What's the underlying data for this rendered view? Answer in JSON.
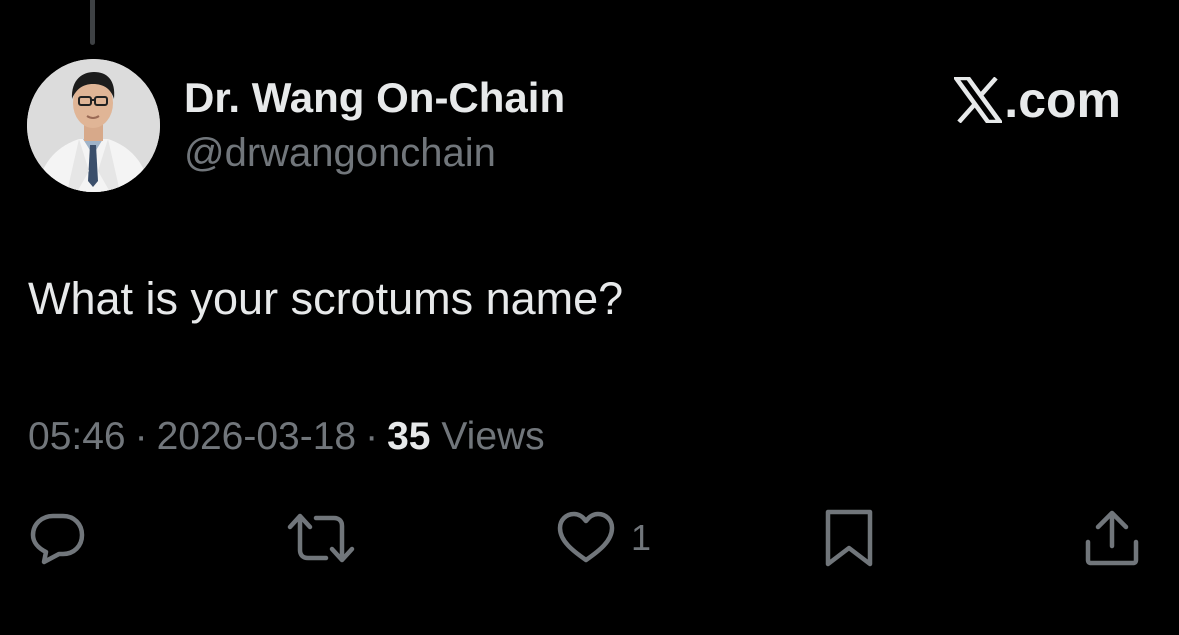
{
  "author": {
    "display_name": "Dr. Wang On-Chain",
    "handle": "@drwangonchain"
  },
  "brand": {
    "text": ".com",
    "icon": "x-logo-icon"
  },
  "tweet": {
    "text": "What is your scrotums name?",
    "time": "05:46",
    "date": "2026-03-18",
    "views_count": "35",
    "views_label": "Views",
    "separator": "·"
  },
  "actions": {
    "reply": {
      "icon": "reply-icon"
    },
    "repost": {
      "icon": "repost-icon"
    },
    "like": {
      "icon": "heart-icon",
      "count": "1"
    },
    "bookmark": {
      "icon": "bookmark-icon"
    },
    "share": {
      "icon": "share-icon"
    }
  },
  "colors": {
    "background": "#000000",
    "primary_text": "#e7e9ea",
    "secondary_text": "#71767b"
  }
}
